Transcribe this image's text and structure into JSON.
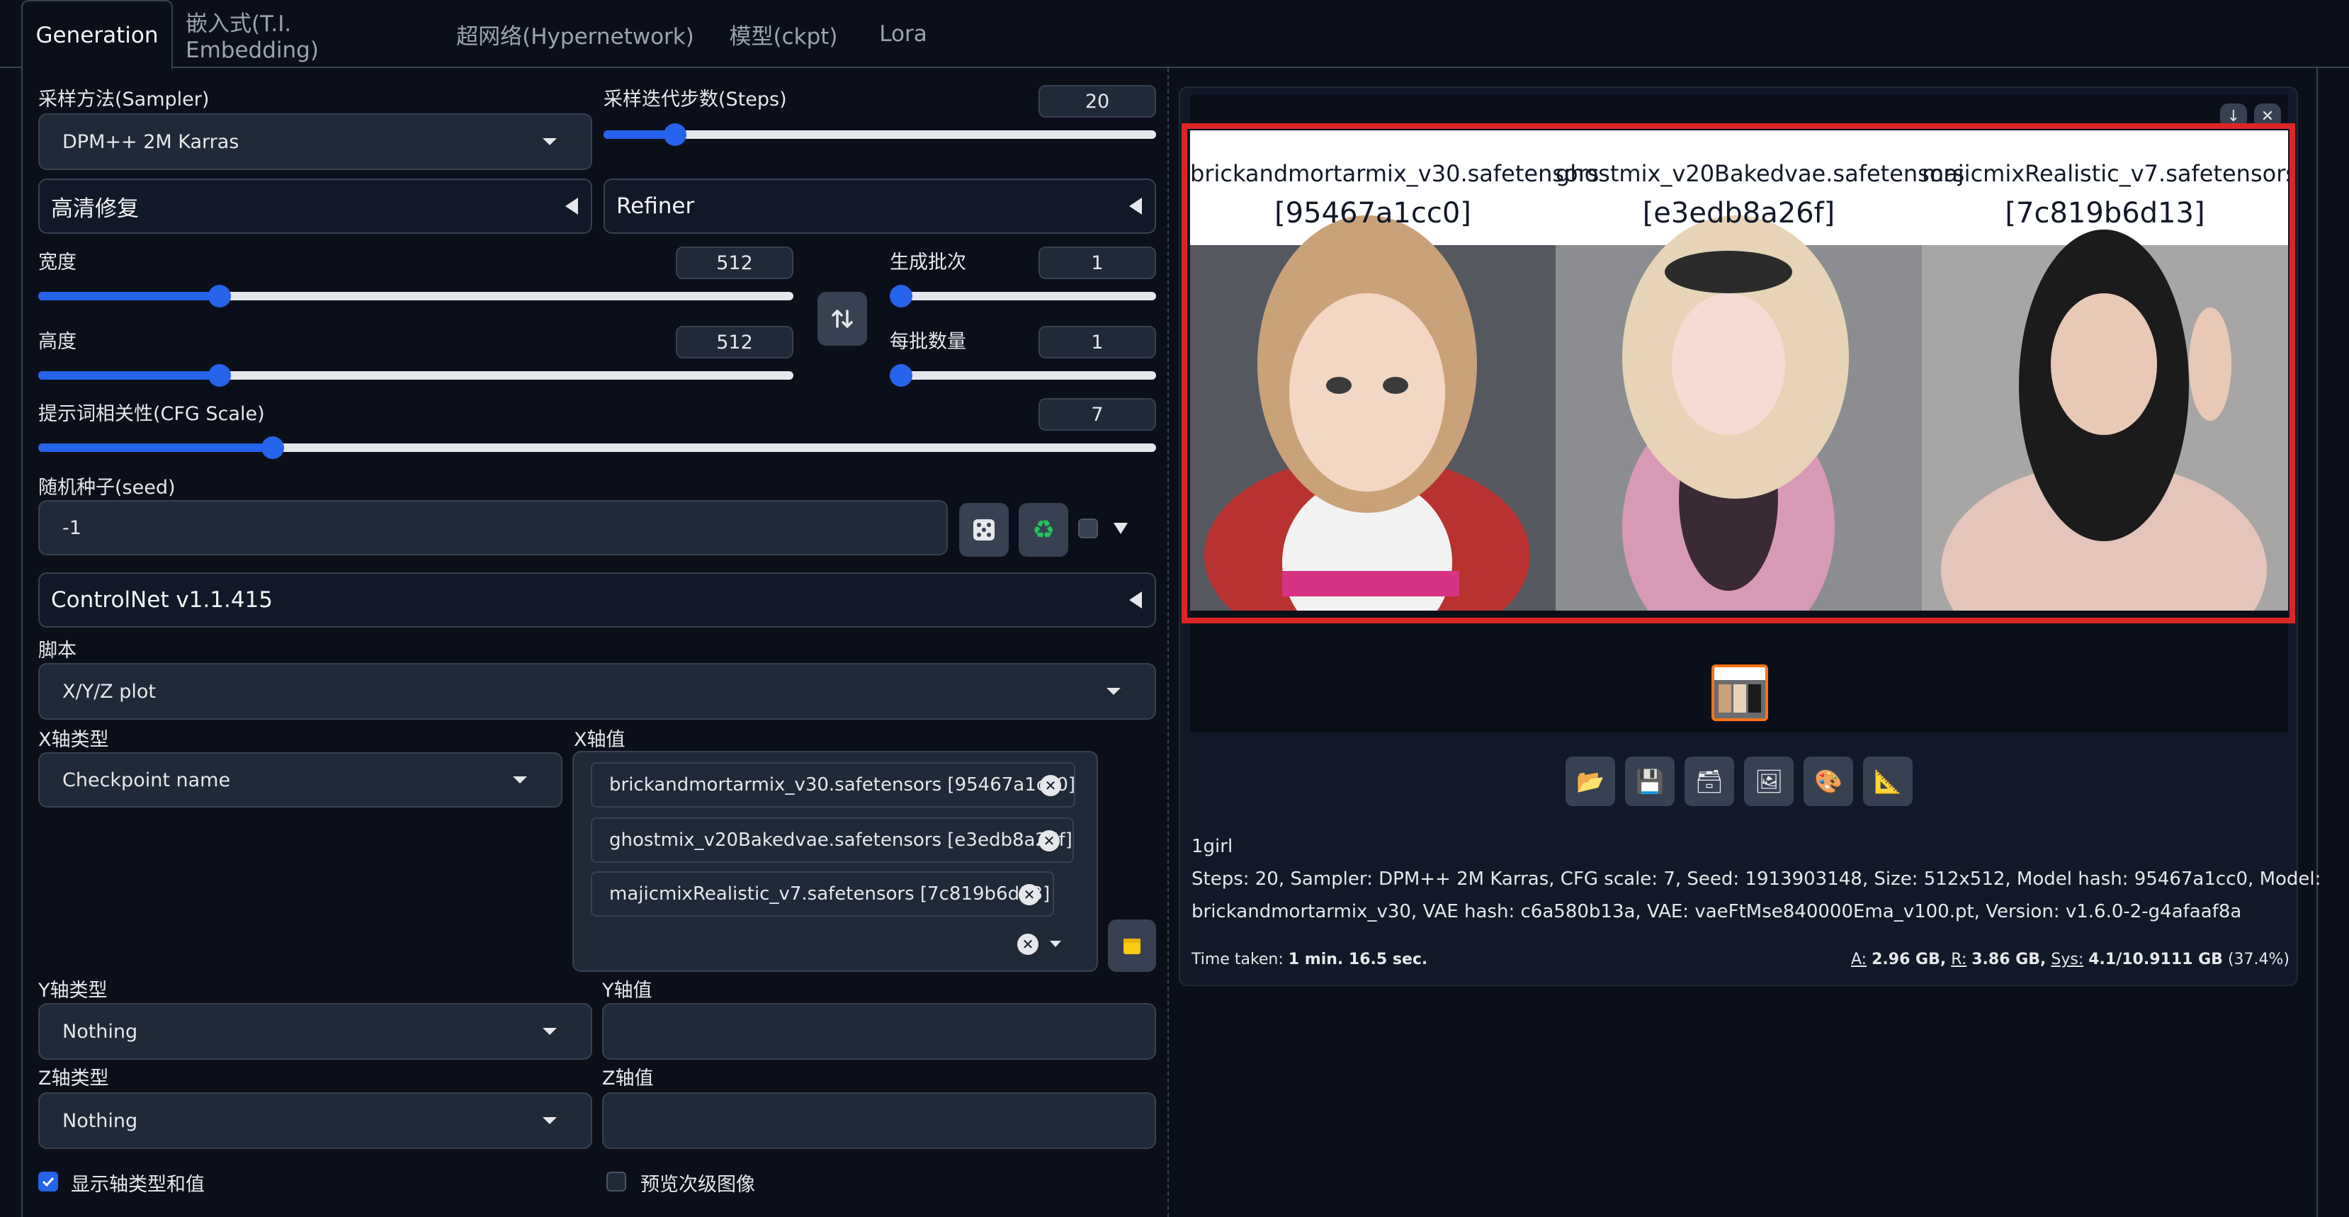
{
  "tabs": [
    {
      "label": "Generation",
      "active": true
    },
    {
      "label": "嵌入式(T.I. Embedding)"
    },
    {
      "label": "超网络(Hypernetwork)"
    },
    {
      "label": "模型(ckpt)"
    },
    {
      "label": "Lora"
    }
  ],
  "sampler": {
    "label": "采样方法(Sampler)",
    "value": "DPM++ 2M Karras"
  },
  "steps": {
    "label": "采样迭代步数(Steps)",
    "value": "20",
    "level": 0.13
  },
  "hires": {
    "label": "高清修复"
  },
  "refiner": {
    "label": "Refiner"
  },
  "width": {
    "label": "宽度",
    "value": "512",
    "level": 0.24
  },
  "height": {
    "label": "高度",
    "value": "512",
    "level": 0.24
  },
  "batch_count": {
    "label": "生成批次",
    "value": "1",
    "level": 0
  },
  "batch_size": {
    "label": "每批数量",
    "value": "1",
    "level": 0
  },
  "cfg": {
    "label": "提示词相关性(CFG Scale)",
    "value": "7",
    "level": 0.21
  },
  "seed": {
    "label": "随机种子(seed)",
    "value": "-1"
  },
  "controlnet": {
    "label": "ControlNet v1.1.415"
  },
  "script": {
    "label": "脚本",
    "value": "X/Y/Z plot"
  },
  "x_type": {
    "label": "X轴类型",
    "value": "Checkpoint name"
  },
  "x_values": {
    "label": "X轴值",
    "items": [
      "brickandmortarmix_v30.safetensors [95467a1cc0]",
      "ghostmix_v20Bakedvae.safetensors [e3edb8a26f]",
      "majicmixRealistic_v7.safetensors [7c819b6d13]"
    ]
  },
  "y_type": {
    "label": "Y轴类型",
    "value": "Nothing"
  },
  "y_values": {
    "label": "Y轴值",
    "value": ""
  },
  "z_type": {
    "label": "Z轴类型",
    "value": "Nothing"
  },
  "z_values": {
    "label": "Z轴值",
    "value": ""
  },
  "draw_legend": {
    "label": "显示轴类型和值",
    "checked": true
  },
  "preview_sub": {
    "label": "预览次级图像",
    "checked": false
  },
  "gallery": {
    "columns": [
      {
        "name": "brickandmortarmix_v30.safetensors",
        "hash": "[95467a1cc0]"
      },
      {
        "name": "ghostmix_v20Bakedvae.safetensors",
        "hash": "[e3edb8a26f]"
      },
      {
        "name": "majicmixRealistic_v7.safetensors",
        "hash": "[7c819b6d13]"
      }
    ],
    "highlight_color": "#dc2626"
  },
  "tools": [
    "folder-icon",
    "save-icon",
    "zip-icon",
    "image-icon",
    "palette-icon",
    "ruler-icon"
  ],
  "info": {
    "prompt": "1girl",
    "params_line1": "Steps: 20, Sampler: DPM++ 2M Karras, CFG scale: 7, Seed: 1913903148, Size: 512x512, Model hash: 95467a1cc0, Model:",
    "params_line2": "brickandmortarmix_v30, VAE hash: c6a580b13a, VAE: vaeFtMse840000Ema_v100.pt, Version: v1.6.0-2-g4afaaf8a",
    "time_label": "Time taken:",
    "time_value": "1 min. 16.5 sec.",
    "mem_a_label": "A:",
    "mem_a": "2.96 GB,",
    "mem_r_label": "R:",
    "mem_r": "3.86 GB,",
    "mem_sys_label": "Sys:",
    "mem_sys": "4.1/10.9111 GB",
    "mem_pct": "(37.4%)"
  },
  "colors": {
    "accent": "#2563eb",
    "bg": "#0b0f19",
    "panel": "#1f2937",
    "thumb_border": "#f97316"
  }
}
